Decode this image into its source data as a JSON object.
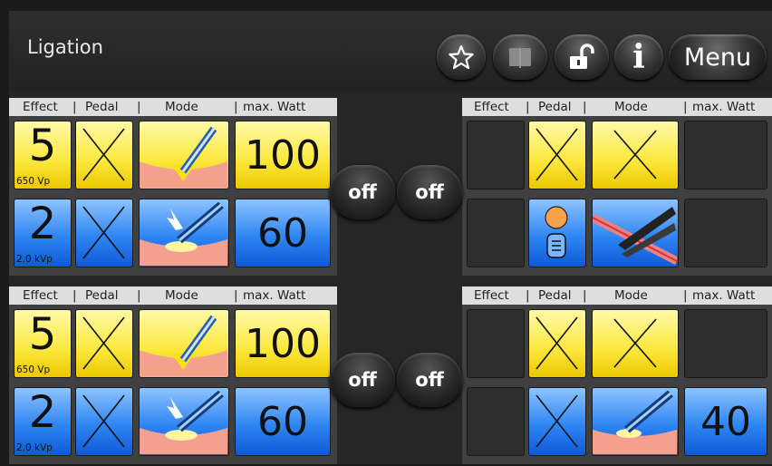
{
  "header": {
    "title": "Ligation",
    "menu_label": "Menu",
    "info_label": "i",
    "icons": [
      "star-icon",
      "book-icon",
      "unlock-icon",
      "info-icon"
    ]
  },
  "column_headers": {
    "effect": "Effect",
    "pedal": "Pedal",
    "mode": "Mode",
    "max_watt": "max. Watt",
    "separator": "|"
  },
  "colors": {
    "yellow": "#fbe73b",
    "blue": "#2f86f2",
    "background": "#262626"
  },
  "off_label": "off",
  "channels": {
    "top_left": {
      "rows": [
        {
          "color": "yellow",
          "effect": "5",
          "effect_sub": "650 Vp",
          "pedal": "none",
          "mode": "cut-instrument-icon",
          "max_watt": "100"
        },
        {
          "color": "blue",
          "effect": "2",
          "effect_sub": "2.0 kVp",
          "pedal": "none",
          "mode": "spray-coag-icon",
          "max_watt": "60"
        }
      ]
    },
    "top_right": {
      "rows": [
        {
          "color": "yellow",
          "effect": "",
          "pedal": "none",
          "mode": "none",
          "max_watt": ""
        },
        {
          "color": "blue",
          "effect": "",
          "pedal": "footswitch-icon",
          "mode": "vessel-sealing-forceps-icon",
          "max_watt": ""
        }
      ]
    },
    "bottom_left": {
      "rows": [
        {
          "color": "yellow",
          "effect": "5",
          "effect_sub": "650 Vp",
          "pedal": "none",
          "mode": "cut-instrument-icon",
          "max_watt": "100"
        },
        {
          "color": "blue",
          "effect": "2",
          "effect_sub": "2.0 kVp",
          "pedal": "none",
          "mode": "spray-coag-icon",
          "max_watt": "60"
        }
      ]
    },
    "bottom_right": {
      "rows": [
        {
          "color": "yellow",
          "effect": "",
          "pedal": "none",
          "mode": "none",
          "max_watt": ""
        },
        {
          "color": "blue",
          "effect": "",
          "pedal": "none",
          "mode": "soft-coag-icon",
          "max_watt": "40"
        }
      ]
    }
  }
}
